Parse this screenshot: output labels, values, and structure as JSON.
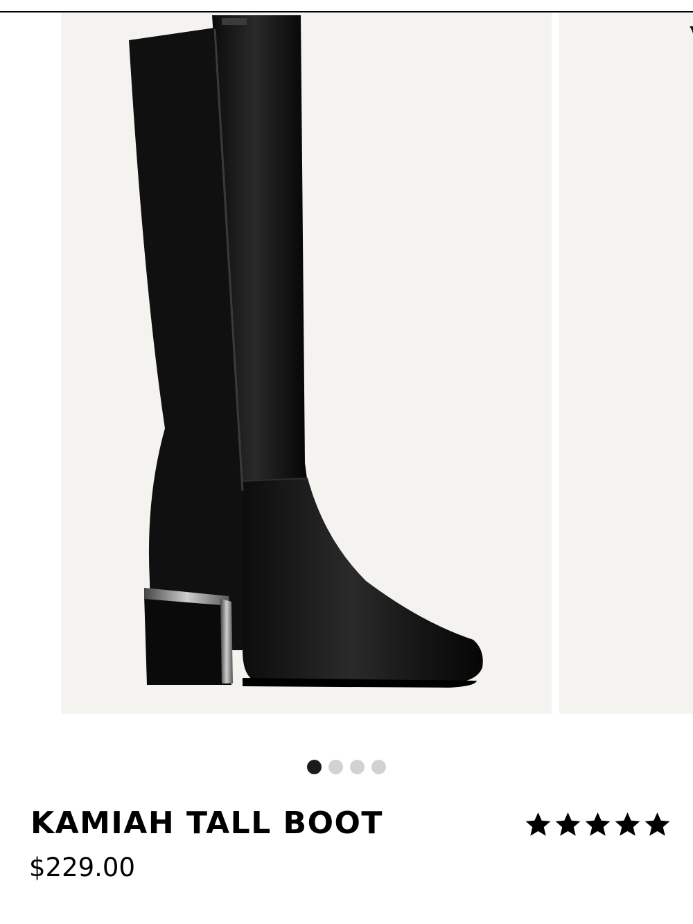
{
  "product": {
    "name": "KAMIAH TALL BOOT",
    "price": "$229.00",
    "image_alt": "Kamiah tall boot, black leather with stretch back panel and metallic block heel"
  },
  "carousel": {
    "slide_count": 4,
    "active_index": 0
  },
  "rating": {
    "stars": 5,
    "max": 5,
    "icon": "star-icon"
  },
  "colors": {
    "image_background": "#f4f3ef",
    "active_dot": "#1b1b1b",
    "inactive_dot": "#d2d2d2"
  }
}
